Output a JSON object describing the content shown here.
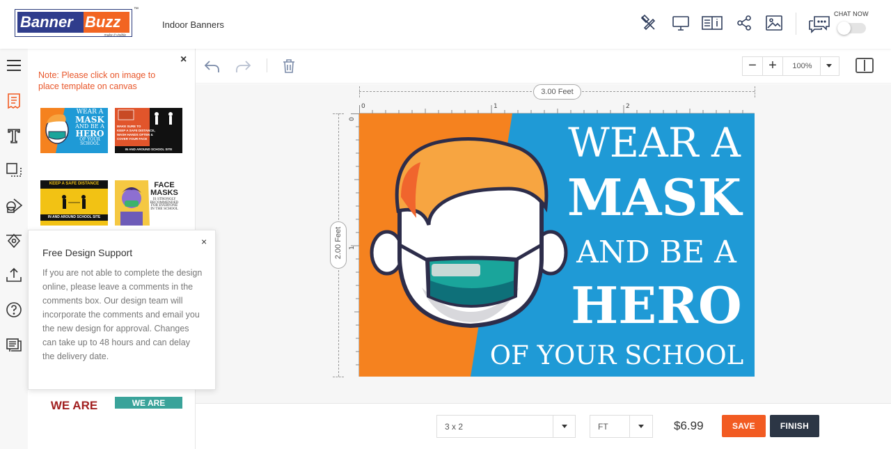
{
  "header": {
    "logo_text_left": "Banner",
    "logo_text_right": "Buzz",
    "logo_tagline": "make it visible",
    "logo_trademark": "™",
    "product_title": "Indoor Banners",
    "icons": [
      "no-design-icon",
      "preview-icon",
      "guide-icon",
      "share-icon",
      "image-icon",
      "chat-icon"
    ],
    "chat_label": "CHAT NOW",
    "chat_toggle_on": false
  },
  "rail": {
    "icons": [
      "menu-icon",
      "templates-icon",
      "text-icon",
      "copy-layers-icon",
      "shapes-icon",
      "clipart-icon",
      "upload-icon",
      "help-icon",
      "comments-icon"
    ]
  },
  "panel": {
    "close": "×",
    "note": "Note: Please click on image to place template on canvas",
    "templates": [
      {
        "lines": [
          "WEAR A",
          "MASK",
          "AND BE A",
          "HERO",
          "OF YOUR SCHOOL"
        ]
      },
      {
        "lines": [
          "MAKE SURE TO",
          "KEEP A SAFE DISTANCE,",
          "WASH HANDS OFTEN &",
          "COVER YOUR FACE",
          "IN AND AROUND SCHOOL SITE"
        ]
      },
      {
        "lines": [
          "KEEP A SAFE DISTANCE",
          "IN AND AROUND SCHOOL SITE"
        ]
      },
      {
        "lines": [
          "FACE",
          "MASKS",
          "IS STRONGLY",
          "RECOMMENDED",
          "FOR EVERYONE",
          "IN THE SCHOOL"
        ]
      },
      {
        "lines": [
          "WE ARE"
        ]
      },
      {
        "lines": [
          "WE ARE"
        ]
      }
    ]
  },
  "support": {
    "title": "Free Design Support",
    "close": "×",
    "body": "If you are not able to complete the design online, please leave a comments in the comments box. Our design team will incorporate the comments and email you the new design for approval. Changes can take up to 48 hours and can delay the delivery date."
  },
  "toolbar": {
    "icons": [
      "undo-icon",
      "redo-icon",
      "delete-icon"
    ],
    "zoom_out": "−",
    "zoom_in": "+",
    "zoom_value": "100%"
  },
  "canvas": {
    "width_label": "3.00 Feet",
    "height_label": "2.00 Feet",
    "ruler_top": [
      "0",
      "1",
      "2"
    ],
    "ruler_left": [
      "0",
      "1"
    ],
    "banner_lines": [
      "WEAR A",
      "MASK",
      "AND BE A",
      "HERO",
      "OF YOUR SCHOOL"
    ],
    "colors": {
      "orange": "#f5821f",
      "blue": "#1f9ad6",
      "hair": "#f7a541",
      "mask": "#1aa59b"
    }
  },
  "bottom": {
    "size_value": "3 x 2",
    "unit_value": "FT",
    "price": "$6.99",
    "save_label": "SAVE",
    "finish_label": "FINISH"
  }
}
